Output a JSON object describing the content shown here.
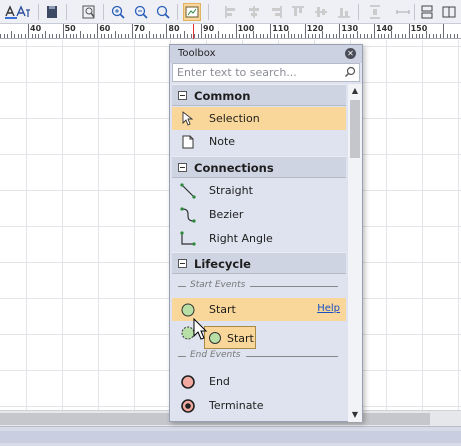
{
  "ruler": {
    "labels": [
      "40",
      "50",
      "60",
      "70",
      "80",
      "90",
      "100",
      "110",
      "120",
      "130",
      "140",
      "150"
    ]
  },
  "toolbar": {
    "icons": [
      "text-color-icon",
      "font-size-icon",
      "notes-icon",
      "zoom-to-fit-icon",
      "zoom-in-icon",
      "zoom-out-icon",
      "zoom-icon",
      "toolbox-icon",
      "align-left-icon",
      "align-center-icon",
      "align-right-icon",
      "align-top-icon",
      "align-middle-icon",
      "align-bottom-icon",
      "space-evenly-icon",
      "same-size-icon",
      "layout-icon"
    ]
  },
  "toolbox": {
    "title": "Toolbox",
    "search_placeholder": "Enter text to search...",
    "groups": {
      "common": {
        "label": "Common",
        "items": [
          "Selection",
          "Note"
        ]
      },
      "connections": {
        "label": "Connections",
        "items": [
          "Straight",
          "Bezier",
          "Right Angle"
        ]
      },
      "lifecycle": {
        "label": "Lifecycle",
        "start_events_label": "Start Events",
        "start_item": "Start",
        "help_link": "Help",
        "end_events_label": "End Events",
        "end_items": [
          "End",
          "Terminate"
        ]
      }
    }
  },
  "drag_ghost": {
    "label": "Start"
  },
  "colors": {
    "selection_highlight": "#f9d699",
    "group_header": "#cfd4e3",
    "toolbox_bg": "#dfe3ef",
    "start_event_fill": "#b8e0a6",
    "end_event_fill": "#f2a9a0"
  }
}
